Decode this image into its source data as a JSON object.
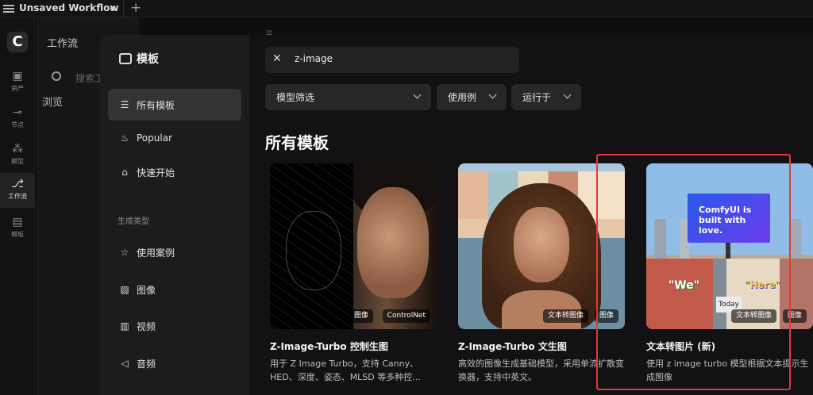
{
  "topbar": {
    "workflow_title": "Unsaved Workflow"
  },
  "rail": {
    "items": [
      {
        "label": "资产",
        "icon": "image-icon"
      },
      {
        "label": "节点",
        "icon": "node-icon"
      },
      {
        "label": "模型",
        "icon": "model-icon"
      },
      {
        "label": "工作流",
        "icon": "workflow-icon"
      },
      {
        "label": "模板",
        "icon": "template-icon"
      }
    ]
  },
  "sidepanel": {
    "title": "工作流",
    "search_placeholder": "搜索工",
    "browse": "浏览"
  },
  "modal": {
    "title": "模板",
    "nav": {
      "all": "所有模板",
      "popular": "Popular",
      "quickstart": "快速开始",
      "section": "生成类型",
      "usecases": "使用案例",
      "image": "图像",
      "video": "视频",
      "audio": "音频"
    },
    "search_value": "z-image",
    "filters": {
      "model": "模型筛选",
      "usecase": "使用例",
      "runon": "运行于"
    },
    "section_title": "所有模板",
    "cards": [
      {
        "title": "Z-Image-Turbo 控制生图",
        "desc": "用于 Z Image Turbo，支持 Canny、HED、深度、姿态、MLSD 等多种控...",
        "badges": [
          "图像",
          "ControlNet"
        ]
      },
      {
        "title": "Z-Image-Turbo 文生图",
        "desc": "高效的图像生成基础模型，采用单流扩散变换器，支持中英文。",
        "badges": [
          "文本转图像",
          "图像"
        ]
      },
      {
        "title": "文本转图片 (新)",
        "desc": "使用 z image turbo 模型根据文本提示生成图像",
        "badges": [
          "文本转图像",
          "图像"
        ],
        "billboard": "ComfyUI is built with love.",
        "graffiti_we": "\"We\"",
        "graffiti_here": "\"Here\"",
        "sign_today": "Today"
      }
    ]
  },
  "colors": {
    "highlight": "#e03a3a",
    "active_nav": "#333336"
  }
}
